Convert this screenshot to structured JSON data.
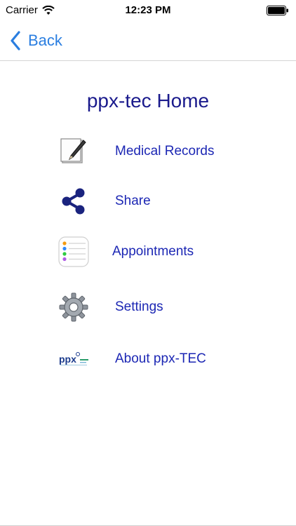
{
  "status_bar": {
    "carrier": "Carrier",
    "time": "12:23 PM",
    "icons": [
      "wifi-icon",
      "battery-icon"
    ]
  },
  "nav": {
    "back_label": "Back",
    "accent_color": "#2a7ee0"
  },
  "page": {
    "title": "ppx-tec Home",
    "title_color": "#1a1a8c"
  },
  "menu": {
    "label_color": "#1c27b4",
    "items": [
      {
        "label": "Medical Records",
        "icon": "notepad-pen-icon"
      },
      {
        "label": "Share",
        "icon": "share-icon"
      },
      {
        "label": "Appointments",
        "icon": "reminders-list-icon"
      },
      {
        "label": "Settings",
        "icon": "gear-icon"
      },
      {
        "label": "About ppx-TEC",
        "icon": "ppx-logo-icon"
      }
    ]
  }
}
